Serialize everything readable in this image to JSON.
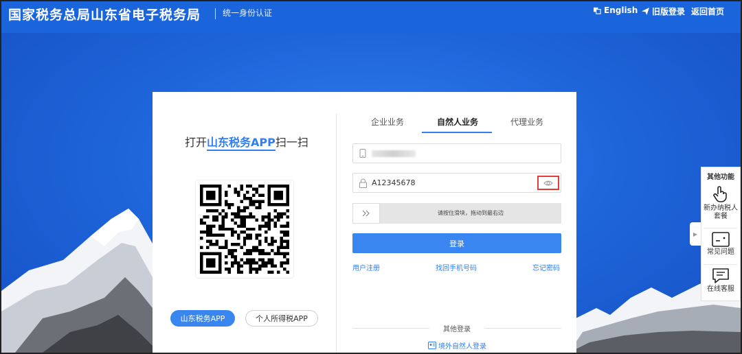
{
  "header": {
    "title": "国家税务总局山东省电子税务局",
    "subtitle": "统一身份认证",
    "links": {
      "english": "English",
      "old_version": "旧版登录",
      "home": "返回首页"
    }
  },
  "qr_panel": {
    "scan_prefix": "打开",
    "scan_app": "山东税务APP",
    "scan_suffix": "扫一扫",
    "app_buttons": {
      "primary": "山东税务APP",
      "secondary": "个人所得税APP"
    }
  },
  "tabs": [
    {
      "label": "企业业务",
      "active": false
    },
    {
      "label": "自然人业务",
      "active": true
    },
    {
      "label": "代理业务",
      "active": false
    }
  ],
  "form": {
    "password_value": "A12345678",
    "slider_text": "请按住滑块，拖动到最右边",
    "login_button": "登录",
    "links": {
      "register": "用户注册",
      "recover_phone": "找回手机号码",
      "forgot_password": "忘记密码"
    },
    "other_login_title": "其他登录",
    "abroad_login": "境外自然人登录"
  },
  "side_panel": {
    "title": "其他功能",
    "items": [
      {
        "label_line1": "新办纳税人",
        "label_line2": "套餐",
        "icon": "hand-pointer-icon"
      },
      {
        "label_line1": "常见问题",
        "label_line2": "",
        "icon": "faq-card-icon"
      },
      {
        "label_line1": "在线客服",
        "label_line2": "",
        "icon": "chat-bubble-icon"
      }
    ]
  },
  "colors": {
    "header_blue": "#1a64dc",
    "accent_blue": "#3a86f0",
    "highlight_red": "#e23b3b"
  }
}
